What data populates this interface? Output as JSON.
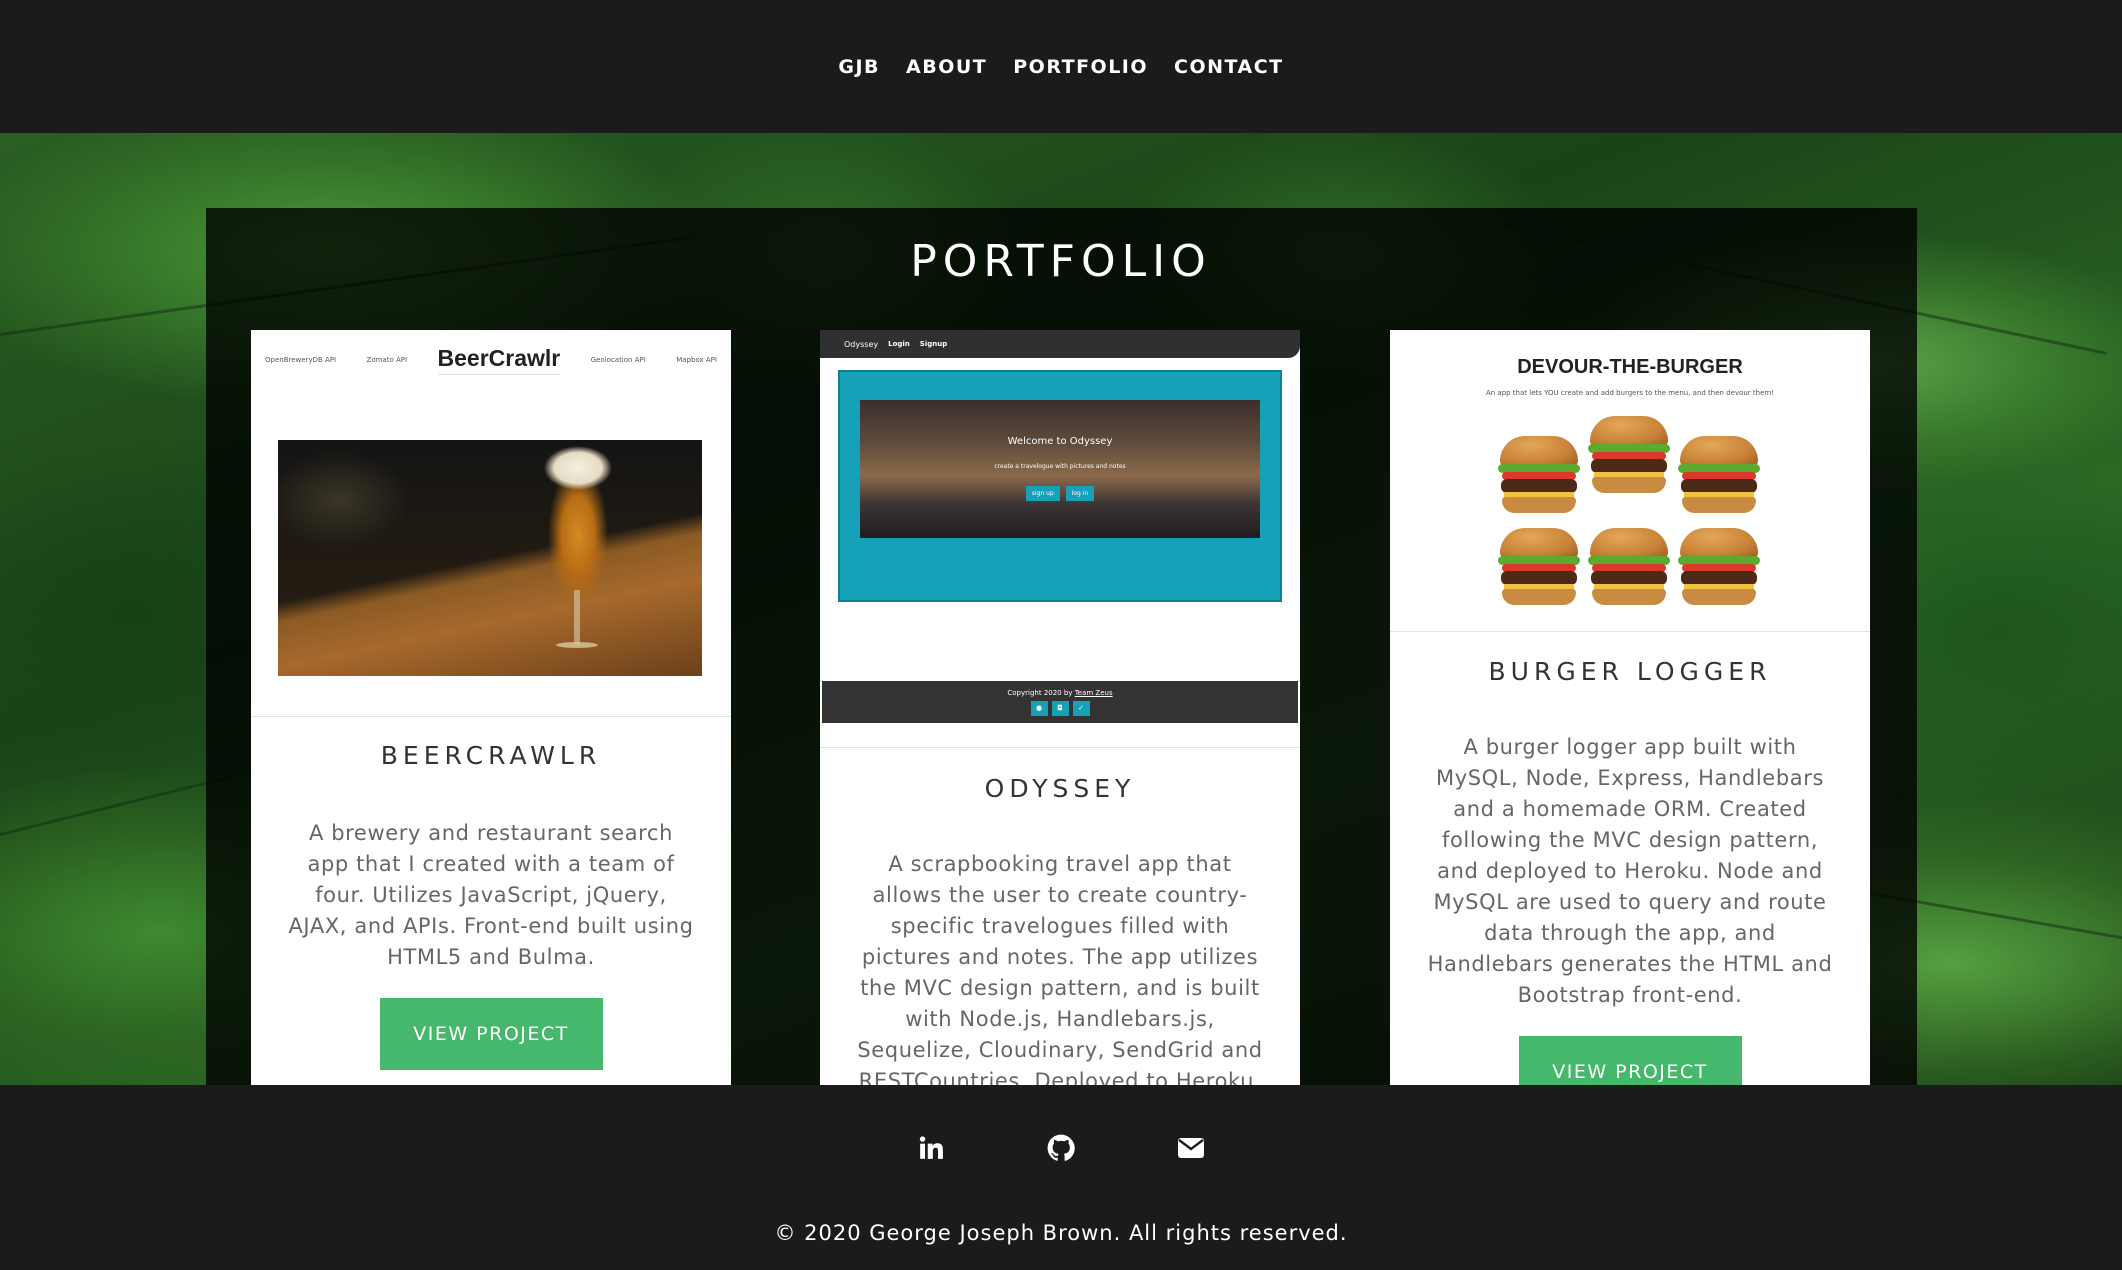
{
  "nav": {
    "items": [
      {
        "label": "GJB"
      },
      {
        "label": "ABOUT"
      },
      {
        "label": "PORTFOLIO"
      },
      {
        "label": "CONTACT"
      }
    ]
  },
  "portfolio": {
    "title": "PORTFOLIO",
    "cards": [
      {
        "screenshot": {
          "brand": "BeerCrawlr",
          "nav_left": [
            "OpenBreweryDB API",
            "Zomato API"
          ],
          "nav_right": [
            "Geolocation API",
            "Mapbox API"
          ]
        },
        "title": "BEERCRAWLR",
        "description": "A brewery and restaurant search app that I created with a team of four. Utilizes JavaScript, jQuery, AJAX, and APIs. Front-end built using HTML5 and Bulma.",
        "button": "VIEW PROJECT"
      },
      {
        "screenshot": {
          "nav_brand": "Odyssey",
          "nav_links": [
            "Login",
            "Signup"
          ],
          "welcome": "Welcome to Odyssey",
          "tagline": "create a travelogue with pictures and notes",
          "buttons": [
            "sign up",
            "log in"
          ],
          "footer_text": "Copyright 2020 by",
          "footer_link": "Team Zeus"
        },
        "title": "ODYSSEY",
        "description": "A scrapbooking travel app that allows the user to create country-specific travelogues filled with pictures and notes. The app utilizes the MVC design pattern, and is built with Node.js, Handlebars.js, Sequelize, Cloudinary, SendGrid and RESTCountries. Deployed to Heroku."
      },
      {
        "screenshot": {
          "title": "DEVOUR-THE-BURGER",
          "subtitle": "An app that lets YOU create and add burgers to the menu, and then devour them!"
        },
        "title": "BURGER LOGGER",
        "description": "A burger logger app built with MySQL, Node, Express, Handlebars and a homemade ORM. Created following the MVC design pattern, and deployed to Heroku. Node and MySQL are used to query and route data through the app, and Handlebars generates the HTML and Bootstrap front-end.",
        "button": "VIEW PROJECT"
      }
    ]
  },
  "footer": {
    "social": [
      {
        "icon": "linkedin-icon"
      },
      {
        "icon": "github-icon"
      },
      {
        "icon": "envelope-icon"
      }
    ],
    "copyright": "© 2020 George Joseph Brown. All rights reserved."
  },
  "colors": {
    "nav_bg": "#1b1b1b",
    "button": "#46b86c",
    "odyssey_accent": "#17a1b8"
  }
}
